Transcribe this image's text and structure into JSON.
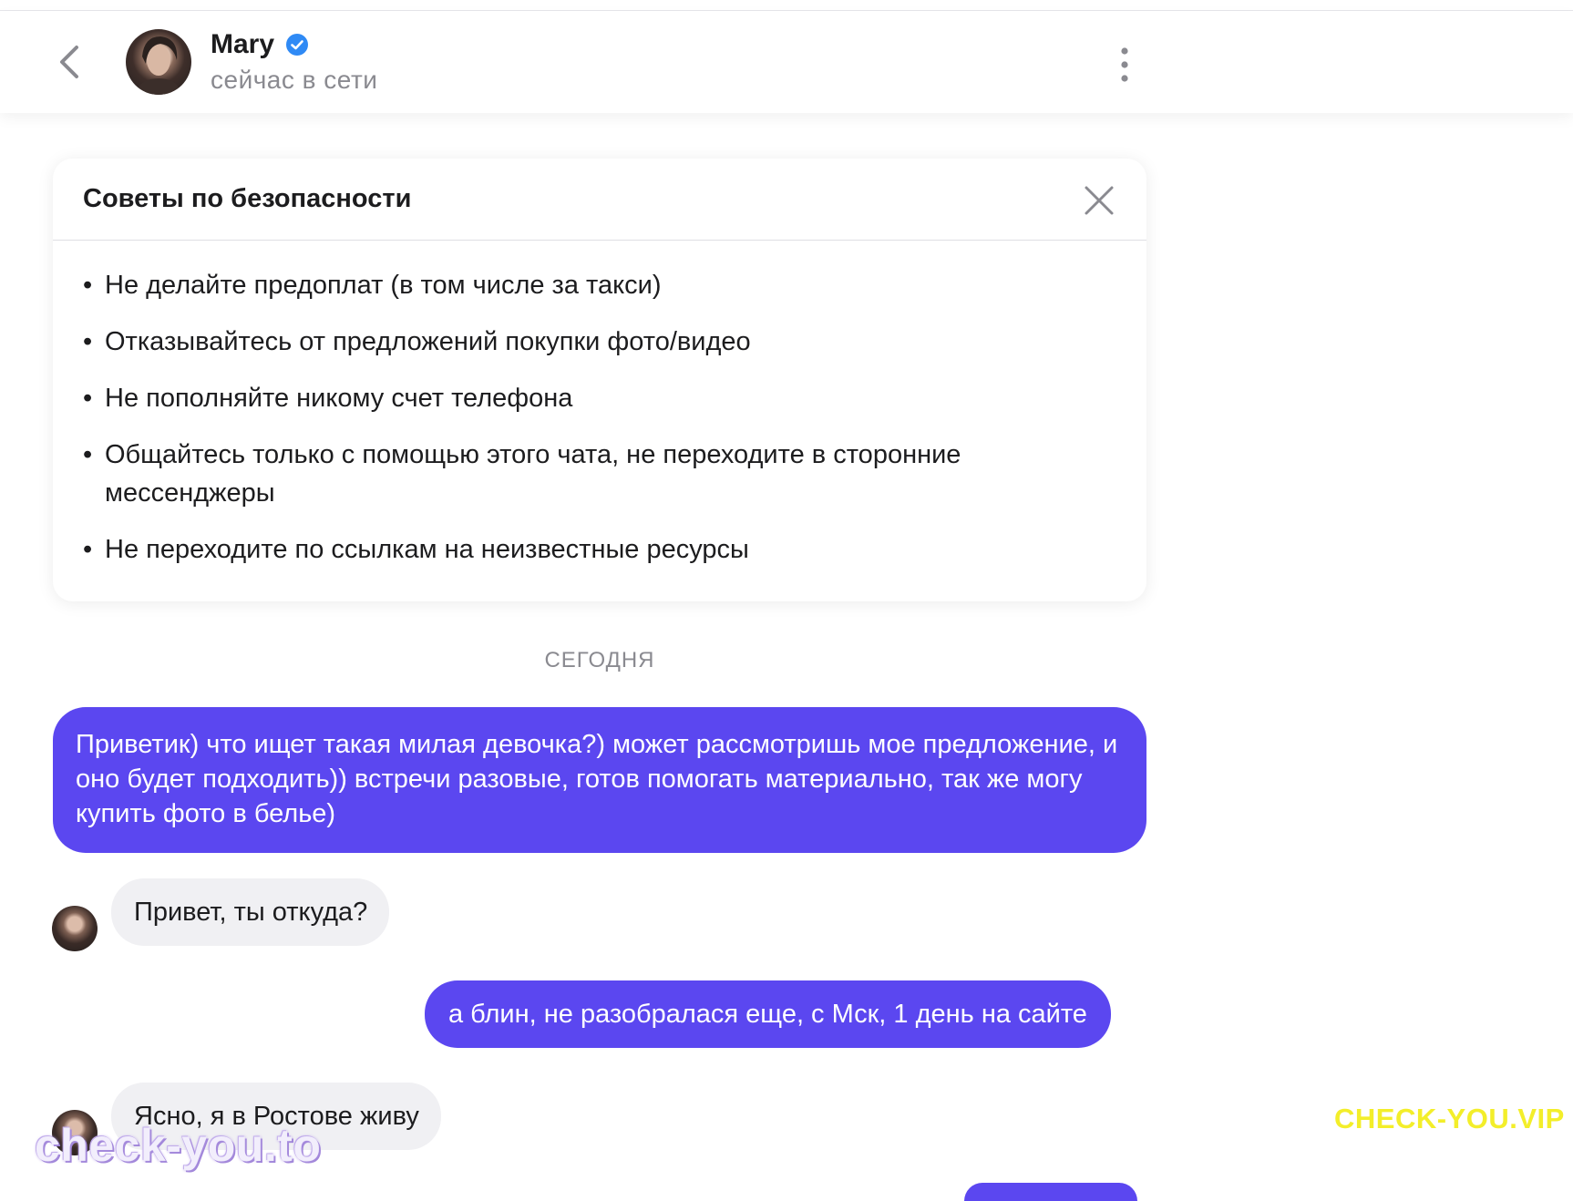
{
  "header": {
    "name": "Mary",
    "status": "сейчас в сети",
    "icons": {
      "back": "chevron-left-icon",
      "verified": "verified-check-icon",
      "more": "more-vertical-icon"
    },
    "accent_color": "#2f8af5"
  },
  "safety": {
    "title": "Советы по безопасности",
    "bullet": "•",
    "close_icon": "close-icon",
    "tips": [
      "Не делайте предоплат (в том числе за такси)",
      "Отказывайтесь от предложений покупки фото/видео",
      "Не пополняйте никому счет телефона",
      "Общайтесь только с помощью этого чата, не переходите в сторонние мессенджеры",
      "Не переходите по ссылкам на неизвестные ресурсы"
    ]
  },
  "chat": {
    "date_divider": "СЕГОДНЯ",
    "colors": {
      "outgoing": "#5b47f0",
      "incoming": "#f0f0f3"
    },
    "messages": [
      {
        "direction": "outgoing",
        "text": "Приветик) что ищет такая милая девочка?) может рассмотришь мое предложение, и оно будет подходить)) встречи разовые, готов помогать материально, так же могу купить фото в белье)"
      },
      {
        "direction": "incoming",
        "text": "Привет, ты откуда?"
      },
      {
        "direction": "outgoing",
        "text": "а блин, не разобралася еще, с Мск, 1 день на сайте"
      },
      {
        "direction": "incoming",
        "text": "Ясно, я в Ростове живу"
      }
    ]
  },
  "watermarks": {
    "left": "check-you.to",
    "right": "CHECK-YOU.VIP"
  }
}
